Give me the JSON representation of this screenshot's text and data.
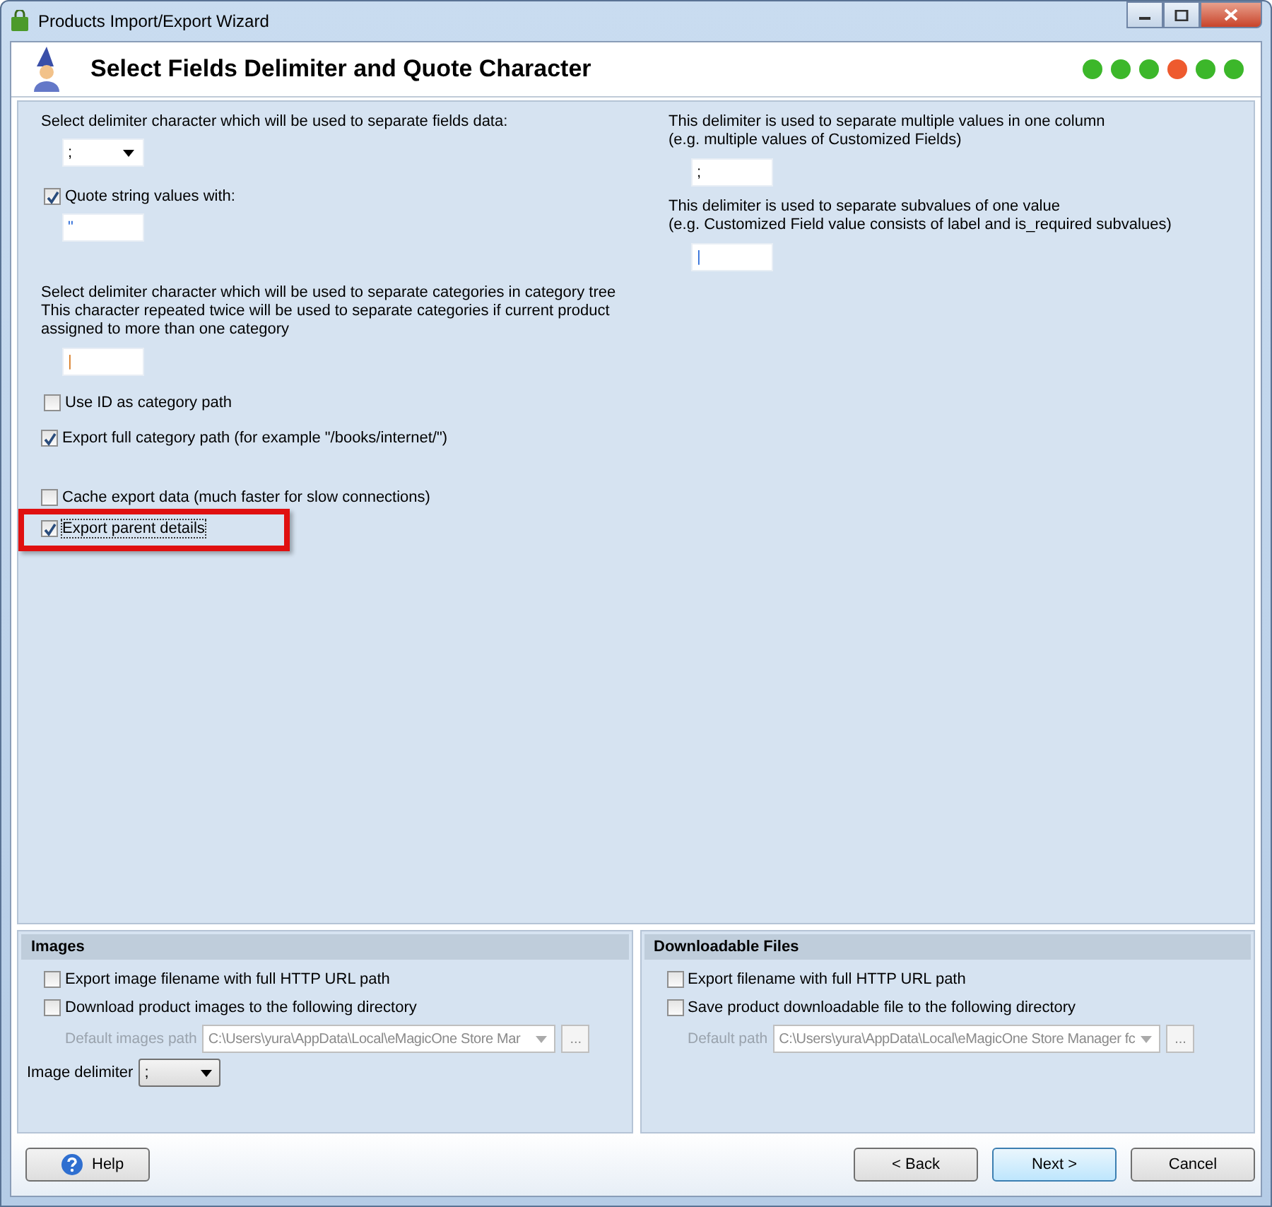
{
  "window": {
    "title": "Products Import/Export Wizard"
  },
  "header": {
    "title": "Select Fields Delimiter and Quote Character",
    "steps": [
      {
        "color": "#3cb72a"
      },
      {
        "color": "#3cb72a"
      },
      {
        "color": "#3cb72a"
      },
      {
        "color": "#ee5a2e"
      },
      {
        "color": "#3cb72a"
      },
      {
        "color": "#3cb72a"
      }
    ]
  },
  "left": {
    "delimiter_label": "Select delimiter character which will be used to separate fields data:",
    "delimiter_value": ";",
    "quote": {
      "label": "Quote string values with:",
      "checked": true,
      "value": "\""
    },
    "category_label": [
      "Select delimiter character which will be used to separate categories in category tree",
      "This character repeated twice will be used to separate categories if current product",
      "assigned to more than one category"
    ],
    "category_value": "|",
    "options": [
      {
        "label": "Use ID as category path",
        "checked": false,
        "highlighted": false
      },
      {
        "label": "Export full category path (for example \"/books/internet/\")",
        "checked": true,
        "highlighted": false
      },
      {
        "label": "Cache export data (much faster for slow connections)",
        "checked": false,
        "highlighted": false
      },
      {
        "label": "Export parent details",
        "checked": true,
        "highlighted": true
      }
    ]
  },
  "right": [
    {
      "label": [
        "This delimiter is used to separate multiple values in one column",
        "(e.g. multiple values of Customized Fields)"
      ],
      "value": ";"
    },
    {
      "label": [
        "This delimiter is used to separate subvalues of one value",
        "(e.g. Customized Field value consists of label and is_required subvalues)"
      ],
      "value": "|"
    }
  ],
  "groups": [
    {
      "title": "Images",
      "checkboxes": [
        {
          "label": "Export image filename with full HTTP URL path",
          "checked": false
        },
        {
          "label": "Download product images to the following directory",
          "checked": false
        }
      ],
      "path": {
        "label": "Default images path",
        "value": "C:\\Users\\yura\\AppData\\Local\\eMagicOne Store Mar",
        "disabled": true,
        "button": "..."
      },
      "extra": {
        "label": "Image delimiter",
        "value": ";"
      }
    },
    {
      "title": "Downloadable Files",
      "checkboxes": [
        {
          "label": "Export filename with full HTTP URL path",
          "checked": false
        },
        {
          "label": "Save product downloadable file to the following directory",
          "checked": false
        }
      ],
      "path": {
        "label": "Default path",
        "value": "C:\\Users\\yura\\AppData\\Local\\eMagicOne Store Manager fc",
        "disabled": true,
        "button": "..."
      }
    }
  ],
  "footer": {
    "help": "Help",
    "buttons": [
      {
        "label": "< Back",
        "default": false
      },
      {
        "label": "Next >",
        "default": true
      },
      {
        "label": "Cancel",
        "default": false
      }
    ]
  }
}
